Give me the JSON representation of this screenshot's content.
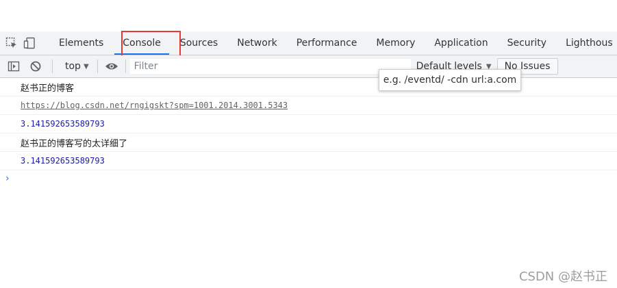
{
  "devtools": {
    "tabs": [
      {
        "label": "Elements"
      },
      {
        "label": "Console"
      },
      {
        "label": "Sources"
      },
      {
        "label": "Network"
      },
      {
        "label": "Performance"
      },
      {
        "label": "Memory"
      },
      {
        "label": "Application"
      },
      {
        "label": "Security"
      },
      {
        "label": "Lighthous"
      }
    ],
    "active_tab": "Console",
    "icons": [
      "inspect-element-icon",
      "device-toggle-icon"
    ],
    "highlight_color": "#e53935",
    "accent_color": "#1a73e8"
  },
  "toolbar": {
    "context": "top",
    "filter_placeholder": "Filter",
    "levels_label": "Default levels",
    "issues_label": "No Issues",
    "icons": [
      "sidebar-toggle-icon",
      "clear-console-icon",
      "eye-icon"
    ]
  },
  "tooltip": {
    "text": "e.g. /eventd/ -cdn url:a.com"
  },
  "console": {
    "messages": [
      {
        "text": "赵书正的博客"
      },
      {
        "text": "https://blog.csdn.net/rngigskt?spm=1001.2014.3001.5343"
      },
      {
        "text": "3.141592653589793"
      },
      {
        "text": "赵书正的博客写的太详细了"
      },
      {
        "text": "3.141592653589793"
      }
    ],
    "prompt": "›"
  },
  "watermark": "CSDN @赵书正"
}
